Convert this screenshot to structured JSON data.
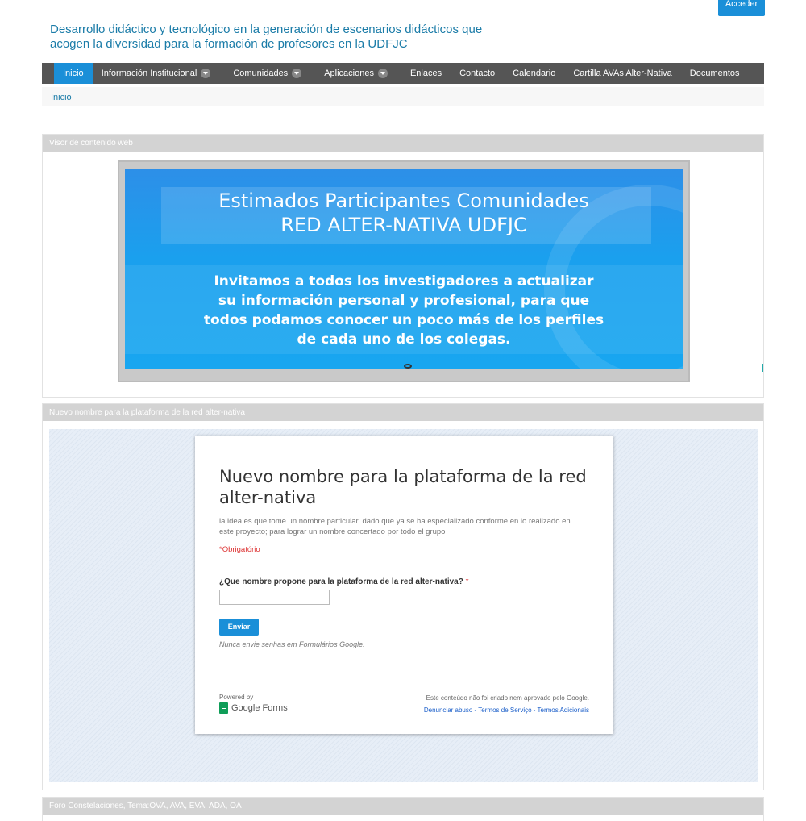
{
  "header": {
    "login_label": "Acceder",
    "site_title": "Desarrollo didáctico y tecnológico en la generación de escenarios didácticos que acogen la diversidad para la formación de profesores en la UDFJC"
  },
  "nav": {
    "items": [
      {
        "label": "Inicio",
        "active": true,
        "has_dropdown": false
      },
      {
        "label": "Información Institucional",
        "active": false,
        "has_dropdown": true
      },
      {
        "label": "Comunidades",
        "active": false,
        "has_dropdown": true
      },
      {
        "label": "Aplicaciones",
        "active": false,
        "has_dropdown": true
      },
      {
        "label": "Enlaces",
        "active": false,
        "has_dropdown": false
      },
      {
        "label": "Contacto",
        "active": false,
        "has_dropdown": false
      },
      {
        "label": "Calendario",
        "active": false,
        "has_dropdown": false
      },
      {
        "label": "Cartilla AVAs Alter-Nativa",
        "active": false,
        "has_dropdown": false
      },
      {
        "label": "Documentos",
        "active": false,
        "has_dropdown": false
      }
    ]
  },
  "breadcrumb": {
    "label": "Inicio"
  },
  "portlet_web": {
    "title": "Visor de contenido web",
    "banner_title_line1": "Estimados Participantes Comunidades",
    "banner_title_line2": "RED ALTER-NATIVA UDFJC",
    "banner_body_line1": "Invitamos a todos los investigadores a actualizar",
    "banner_body_line2": "su información personal y profesional, para que",
    "banner_body_line3": "todos podamos conocer un poco más de los perfiles",
    "banner_body_line4": "de cada uno de los colegas."
  },
  "portlet_form": {
    "title": "Nuevo nombre para la plataforma de la red alter-nativa",
    "form_title": "Nuevo nombre para la plataforma de la red alter-nativa",
    "form_desc": "la idea es que tome un nombre particular, dado que ya se ha especializado conforme en lo realizado en este proyecto; para lograr un nombre concertado por todo el grupo",
    "required_note": "*Obrigatório",
    "question": "¿Que nombre propone para la plataforma de la red alter-nativa?",
    "question_required_mark": "*",
    "answer_value": "",
    "submit_label": "Enviar",
    "never_note": "Nunca envie senhas em Formulários Google.",
    "powered_by": "Powered by",
    "gforms_label": "Google Forms",
    "disclaimer": "Este conteúdo não foi criado nem aprovado pelo Google.",
    "link_abuse": "Denunciar abuso",
    "link_terms": "Termos de Serviço",
    "link_additional": "Termos Adicionais",
    "link_separator": " - "
  },
  "portlet_next": {
    "title": "Foro Constelaciones, Tema:OVA, AVA, EVA, ADA, OA"
  },
  "colors": {
    "accent": "#1a8fd8",
    "nav_bg": "#555555",
    "title_color": "#1b7ca8",
    "portlet_header": "#d3d3d3"
  }
}
